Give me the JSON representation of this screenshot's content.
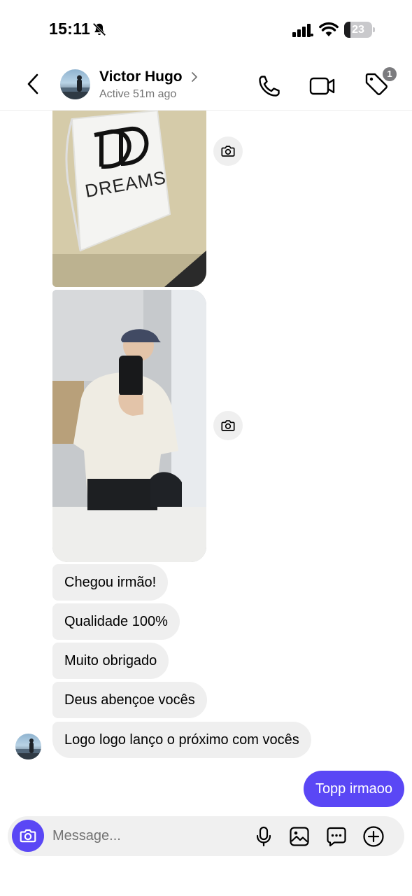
{
  "status_bar": {
    "time": "15:11",
    "battery_level": "23",
    "icons": [
      "mute-bell-icon",
      "signal-icon",
      "wifi-icon",
      "battery-icon"
    ]
  },
  "header": {
    "contact_name": "Victor Hugo",
    "active_status": "Active 51m ago",
    "tag_badge_count": "1",
    "icons": [
      "back-arrow-icon",
      "chevron-right-icon",
      "phone-icon",
      "video-camera-icon",
      "tag-icon"
    ]
  },
  "photos": [
    {
      "type": "received-photo",
      "logo_text": "DREAMS"
    },
    {
      "type": "received-photo"
    }
  ],
  "messages": [
    {
      "from": "contact",
      "text": "Chegou irmão!"
    },
    {
      "from": "contact",
      "text": "Qualidade 100%"
    },
    {
      "from": "contact",
      "text": "Muito obrigado"
    },
    {
      "from": "contact",
      "text": "Deus abençoe vocês"
    },
    {
      "from": "contact",
      "text": "Logo logo lanço o próximo com vocês"
    },
    {
      "from": "me",
      "text": "Topp irmaoo"
    }
  ],
  "composer": {
    "placeholder": "Message...",
    "icons": [
      "camera-icon",
      "microphone-icon",
      "gallery-icon",
      "sticker-icon",
      "plus-icon"
    ]
  },
  "colors": {
    "accent": "#5a47f5",
    "received_bubble": "#efefef",
    "secondary_text": "#737373"
  }
}
